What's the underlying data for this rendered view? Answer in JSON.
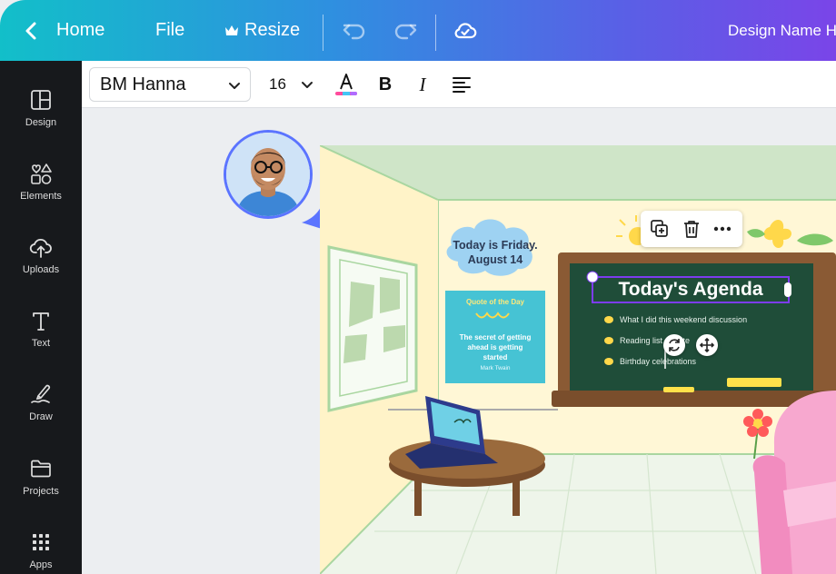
{
  "topbar": {
    "home_label": "Home",
    "file_label": "File",
    "resize_label": "Resize",
    "design_name": "Design Name H",
    "icons": [
      "chevron-left-icon",
      "crown-icon",
      "undo-icon",
      "redo-icon",
      "cloud-sync-icon"
    ]
  },
  "sidebar": {
    "items": [
      {
        "label": "Design",
        "icon": "layout-icon"
      },
      {
        "label": "Elements",
        "icon": "shapes-icon"
      },
      {
        "label": "Uploads",
        "icon": "cloud-upload-icon"
      },
      {
        "label": "Text",
        "icon": "text-icon"
      },
      {
        "label": "Draw",
        "icon": "pen-icon"
      },
      {
        "label": "Projects",
        "icon": "folder-icon"
      },
      {
        "label": "Apps",
        "icon": "grid-icon"
      }
    ]
  },
  "toolbar": {
    "font_family": "BM Hanna",
    "font_size": "16",
    "icons": [
      "chevron-down-icon",
      "text-color-icon",
      "bold-icon",
      "italic-icon",
      "align-left-icon"
    ],
    "text_color_bar": "#ff4b9c"
  },
  "canvas": {
    "date_line1": "Today is Friday.",
    "date_line2": "August 14",
    "quote_title": "Quote of the Day",
    "quote_text": "The secret of getting ahead is getting started",
    "quote_author": "Mark Twain",
    "agenda_title": "Today's Agenda",
    "agenda_items": [
      "What I did this weekend discussion",
      "Reading list update",
      "Birthday celebrations"
    ],
    "selection_toolbar_icons": [
      "duplicate-icon",
      "trash-icon",
      "more-icon"
    ],
    "handle_icons": [
      "rotate-icon",
      "move-icon"
    ]
  },
  "colors": {
    "sidebar_bg": "#17191c",
    "selection": "#7d3cf0",
    "cursor_accent": "#5b74ff"
  }
}
